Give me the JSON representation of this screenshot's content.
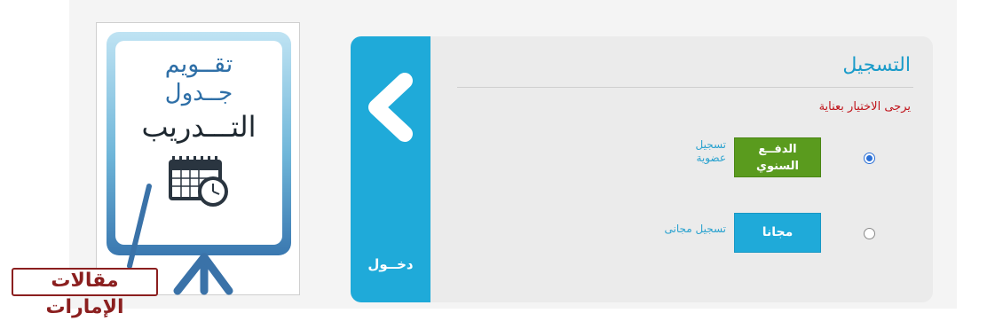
{
  "promo": {
    "line1": "تقــويم",
    "line2": "جــدول",
    "line3": "التـــدريب"
  },
  "logo": {
    "text": "مقالات الإمارات"
  },
  "login": {
    "label": "دخــول"
  },
  "registration": {
    "title": "التسجيل",
    "hint": "يرجى الاختيار بعناية",
    "options": [
      {
        "button": "الدفــع\nالسنوي",
        "caption": "تسجيل\nعضوية",
        "selected": true
      },
      {
        "button": "مجانا",
        "caption": "تسجيل مجانى",
        "selected": false
      }
    ]
  },
  "colors": {
    "accent": "#1faad9",
    "annual_button": "#5a9b1e",
    "hint_text": "#c0141b"
  },
  "icons": [
    "calendar-clock-icon",
    "chevron-left-icon"
  ]
}
